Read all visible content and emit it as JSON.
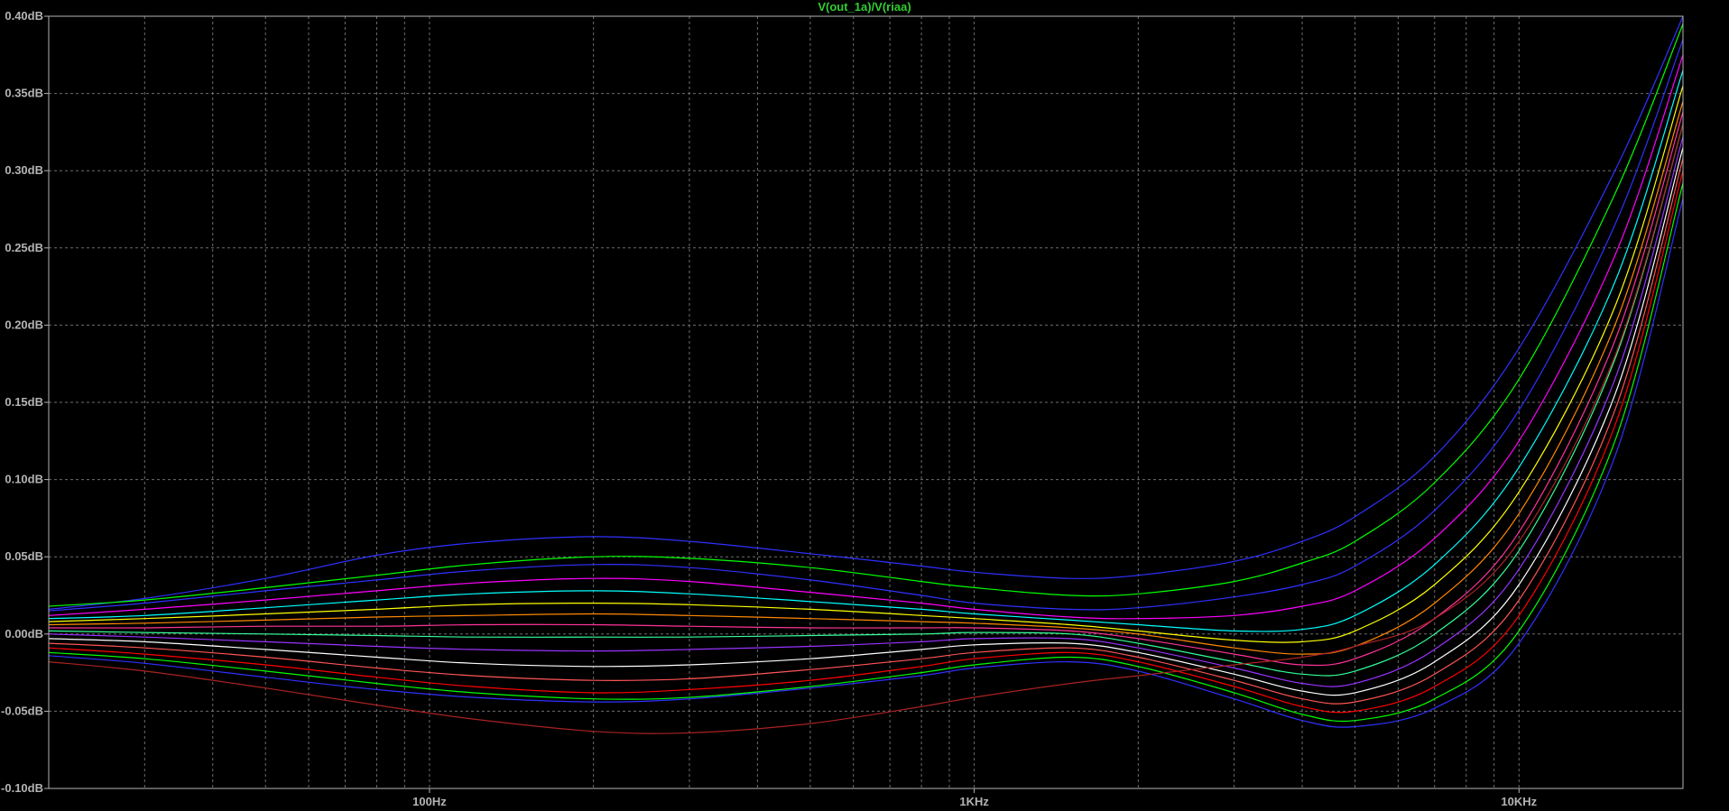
{
  "chart_data": {
    "type": "line",
    "title": "V(out_1a)/V(riaa)",
    "title_color": "#32cd32",
    "background": "#000000",
    "grid": true,
    "grid_color": "#8a8a8a",
    "axis_color": "#b4b4b4",
    "x_scale": "log",
    "xlim": [
      20,
      20000
    ],
    "ylim": [
      -0.1,
      0.4
    ],
    "x_ticks": [
      {
        "value": 100,
        "label": "100Hz"
      },
      {
        "value": 1000,
        "label": "1KHz"
      },
      {
        "value": 10000,
        "label": "10KHz"
      }
    ],
    "y_ticks": [
      {
        "value": 0.4,
        "label": "0.40dB"
      },
      {
        "value": 0.35,
        "label": "0.35dB"
      },
      {
        "value": 0.3,
        "label": "0.30dB"
      },
      {
        "value": 0.25,
        "label": "0.25dB"
      },
      {
        "value": 0.2,
        "label": "0.20dB"
      },
      {
        "value": 0.15,
        "label": "0.15dB"
      },
      {
        "value": 0.1,
        "label": "0.10dB"
      },
      {
        "value": 0.05,
        "label": "0.05dB"
      },
      {
        "value": 0.0,
        "label": "0.00dB"
      },
      {
        "value": -0.05,
        "label": "-0.05dB"
      },
      {
        "value": -0.1,
        "label": "-0.10dB"
      }
    ],
    "series_colors": [
      "#ff0000",
      "#00ff00",
      "#3030ff",
      "#ff00ff",
      "#00ffff",
      "#ffff00",
      "#ff8800",
      "#ff3399",
      "#33ff99",
      "#9933ff",
      "#ffffff",
      "#ff5555"
    ],
    "series": [
      {
        "x": [
          20,
          30,
          50,
          80,
          120,
          200,
          300,
          500,
          800,
          1000,
          1500,
          2000,
          3000,
          4000,
          5000,
          7000,
          10000,
          15000,
          20000
        ],
        "values": [
          0.016,
          0.023,
          0.036,
          0.051,
          0.059,
          0.063,
          0.06,
          0.052,
          0.044,
          0.04,
          0.036,
          0.038,
          0.047,
          0.06,
          0.076,
          0.115,
          0.185,
          0.3,
          0.4
        ]
      },
      {
        "x": [
          20,
          30,
          50,
          80,
          120,
          200,
          300,
          500,
          800,
          1000,
          1500,
          2000,
          3000,
          4000,
          5000,
          7000,
          10000,
          15000,
          20000
        ],
        "values": [
          0.018,
          0.022,
          0.03,
          0.038,
          0.045,
          0.05,
          0.049,
          0.043,
          0.034,
          0.03,
          0.025,
          0.026,
          0.034,
          0.046,
          0.06,
          0.098,
          0.165,
          0.285,
          0.395
        ]
      },
      {
        "x": [
          20,
          30,
          50,
          80,
          120,
          200,
          300,
          500,
          800,
          1000,
          1500,
          2000,
          3000,
          4000,
          5000,
          7000,
          10000,
          15000,
          20000
        ],
        "values": [
          0.015,
          0.02,
          0.028,
          0.035,
          0.041,
          0.045,
          0.043,
          0.035,
          0.025,
          0.02,
          0.016,
          0.017,
          0.024,
          0.032,
          0.044,
          0.08,
          0.145,
          0.265,
          0.385
        ]
      },
      {
        "x": [
          20,
          30,
          50,
          80,
          120,
          200,
          300,
          500,
          800,
          1000,
          1500,
          2000,
          3000,
          4000,
          5000,
          7000,
          10000,
          15000,
          20000
        ],
        "values": [
          0.012,
          0.016,
          0.022,
          0.028,
          0.033,
          0.036,
          0.034,
          0.027,
          0.02,
          0.016,
          0.011,
          0.01,
          0.012,
          0.018,
          0.028,
          0.062,
          0.125,
          0.245,
          0.375
        ]
      },
      {
        "x": [
          20,
          30,
          50,
          80,
          120,
          200,
          300,
          500,
          800,
          1000,
          1500,
          2000,
          3000,
          4000,
          5000,
          7000,
          10000,
          15000,
          20000
        ],
        "values": [
          0.01,
          0.012,
          0.017,
          0.022,
          0.026,
          0.028,
          0.026,
          0.021,
          0.016,
          0.013,
          0.009,
          0.006,
          0.002,
          0.003,
          0.012,
          0.045,
          0.108,
          0.228,
          0.365
        ]
      },
      {
        "x": [
          20,
          30,
          50,
          80,
          120,
          200,
          300,
          500,
          800,
          1000,
          1500,
          2000,
          3000,
          4000,
          5000,
          7000,
          10000,
          15000,
          20000
        ],
        "values": [
          0.008,
          0.01,
          0.013,
          0.016,
          0.019,
          0.02,
          0.019,
          0.016,
          0.012,
          0.01,
          0.006,
          0.002,
          -0.004,
          -0.005,
          0.002,
          0.032,
          0.092,
          0.212,
          0.355
        ]
      },
      {
        "x": [
          20,
          30,
          50,
          80,
          120,
          200,
          300,
          500,
          800,
          1000,
          1500,
          2000,
          3000,
          4000,
          5000,
          7000,
          10000,
          15000,
          20000
        ],
        "values": [
          0.006,
          0.007,
          0.009,
          0.011,
          0.012,
          0.013,
          0.012,
          0.01,
          0.008,
          0.007,
          0.004,
          0.0,
          -0.009,
          -0.013,
          -0.008,
          0.02,
          0.078,
          0.2,
          0.345
        ]
      },
      {
        "x": [
          20,
          30,
          50,
          80,
          120,
          200,
          300,
          500,
          800,
          1000,
          1500,
          2000,
          3000,
          4000,
          5000,
          7000,
          10000,
          15000,
          20000
        ],
        "values": [
          0.004,
          0.004,
          0.005,
          0.005,
          0.006,
          0.006,
          0.005,
          0.004,
          0.004,
          0.004,
          0.002,
          -0.003,
          -0.013,
          -0.02,
          -0.016,
          0.01,
          0.066,
          0.19,
          0.338
        ]
      },
      {
        "x": [
          20,
          30,
          50,
          80,
          120,
          200,
          300,
          500,
          800,
          1000,
          1500,
          2000,
          3000,
          4000,
          5000,
          7000,
          10000,
          15000,
          20000
        ],
        "values": [
          0.002,
          0.001,
          0.0,
          -0.001,
          -0.002,
          -0.002,
          -0.002,
          -0.001,
          0.0,
          0.001,
          0.0,
          -0.006,
          -0.018,
          -0.026,
          -0.024,
          0.0,
          0.054,
          0.178,
          0.33
        ]
      },
      {
        "x": [
          20,
          30,
          50,
          80,
          120,
          200,
          300,
          500,
          800,
          1000,
          1500,
          2000,
          3000,
          4000,
          5000,
          7000,
          10000,
          15000,
          20000
        ],
        "values": [
          0.0,
          -0.002,
          -0.005,
          -0.008,
          -0.01,
          -0.011,
          -0.01,
          -0.008,
          -0.005,
          -0.003,
          -0.003,
          -0.009,
          -0.022,
          -0.032,
          -0.032,
          -0.01,
          0.042,
          0.165,
          0.322
        ]
      },
      {
        "x": [
          20,
          30,
          50,
          80,
          120,
          200,
          300,
          500,
          800,
          1000,
          1500,
          2000,
          3000,
          4000,
          5000,
          7000,
          10000,
          15000,
          20000
        ],
        "values": [
          -0.003,
          -0.005,
          -0.01,
          -0.015,
          -0.019,
          -0.021,
          -0.02,
          -0.016,
          -0.01,
          -0.007,
          -0.006,
          -0.012,
          -0.026,
          -0.037,
          -0.038,
          -0.018,
          0.032,
          0.155,
          0.315
        ]
      },
      {
        "x": [
          20,
          30,
          50,
          80,
          120,
          200,
          300,
          500,
          800,
          1000,
          1500,
          2000,
          3000,
          4000,
          5000,
          7000,
          10000,
          15000,
          20000
        ],
        "values": [
          -0.006,
          -0.009,
          -0.015,
          -0.022,
          -0.027,
          -0.03,
          -0.029,
          -0.023,
          -0.016,
          -0.012,
          -0.009,
          -0.015,
          -0.03,
          -0.042,
          -0.044,
          -0.026,
          0.022,
          0.145,
          0.308
        ]
      },
      {
        "x": [
          20,
          30,
          50,
          80,
          120,
          200,
          300,
          500,
          800,
          1000,
          1500,
          2000,
          3000,
          4000,
          5000,
          7000,
          10000,
          15000,
          20000
        ],
        "values": [
          -0.009,
          -0.013,
          -0.02,
          -0.028,
          -0.034,
          -0.038,
          -0.036,
          -0.03,
          -0.021,
          -0.016,
          -0.012,
          -0.018,
          -0.034,
          -0.047,
          -0.05,
          -0.034,
          0.012,
          0.135,
          0.3
        ]
      },
      {
        "x": [
          20,
          30,
          50,
          80,
          120,
          200,
          300,
          500,
          800,
          1000,
          1500,
          2000,
          3000,
          4000,
          5000,
          7000,
          10000,
          15000,
          20000
        ],
        "values": [
          -0.012,
          -0.016,
          -0.024,
          -0.032,
          -0.038,
          -0.042,
          -0.041,
          -0.034,
          -0.025,
          -0.02,
          -0.015,
          -0.021,
          -0.038,
          -0.052,
          -0.056,
          -0.042,
          0.002,
          0.125,
          0.292
        ]
      },
      {
        "x": [
          20,
          30,
          50,
          80,
          120,
          200,
          300,
          500,
          800,
          1000,
          1500,
          2000,
          3000,
          4000,
          5000,
          7000,
          10000,
          15000,
          20000
        ],
        "values": [
          -0.014,
          -0.019,
          -0.028,
          -0.036,
          -0.041,
          -0.044,
          -0.042,
          -0.035,
          -0.027,
          -0.022,
          -0.018,
          -0.024,
          -0.042,
          -0.056,
          -0.06,
          -0.048,
          -0.006,
          0.115,
          0.282
        ]
      },
      {
        "x": [
          20,
          30,
          50,
          80,
          120,
          200,
          300,
          500,
          800,
          1000,
          1500,
          2000,
          3000,
          4000,
          5000,
          7000,
          10000,
          15000,
          20000
        ],
        "values": [
          -0.018,
          -0.024,
          -0.035,
          -0.046,
          -0.055,
          -0.063,
          -0.064,
          -0.058,
          -0.047,
          -0.041,
          -0.032,
          -0.027,
          -0.02,
          -0.015,
          -0.008,
          0.01,
          0.06,
          0.18,
          0.33
        ]
      }
    ]
  }
}
